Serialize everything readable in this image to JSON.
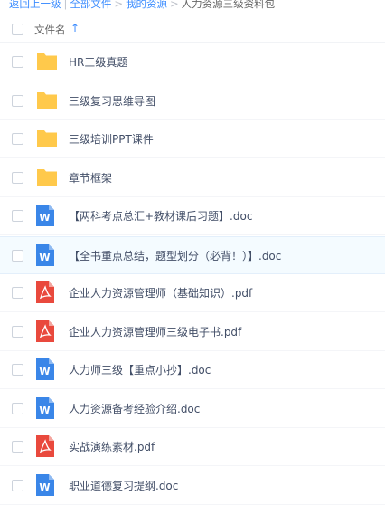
{
  "breadcrumb": {
    "back": "返回上一级",
    "sep1": "|",
    "all_files": "全部文件",
    "sep2": ">",
    "my_resources": "我的资源",
    "sep3": ">",
    "current": "人力资源三级资料包"
  },
  "header": {
    "column_label": "文件名",
    "sort_icon": "↑"
  },
  "files": [
    {
      "name": "HR三级真题",
      "type": "folder"
    },
    {
      "name": "三级复习思维导图",
      "type": "folder"
    },
    {
      "name": "三级培训PPT课件",
      "type": "folder"
    },
    {
      "name": "章节框架",
      "type": "folder"
    },
    {
      "name": "【两科考点总汇+教材课后习题】.doc",
      "type": "doc"
    },
    {
      "name": "【全书重点总结，题型划分（必背！）】.doc",
      "type": "doc"
    },
    {
      "name": "企业人力资源管理师（基础知识）.pdf",
      "type": "pdf"
    },
    {
      "name": "企业人力资源管理师三级电子书.pdf",
      "type": "pdf"
    },
    {
      "name": "人力师三级【重点小抄】.doc",
      "type": "doc"
    },
    {
      "name": "人力资源备考经验介绍.doc",
      "type": "doc"
    },
    {
      "name": "实战演练素材.pdf",
      "type": "pdf"
    },
    {
      "name": "职业道德复习提纲.doc",
      "type": "doc"
    }
  ],
  "colors": {
    "link": "#3b8cff",
    "folder": "#ffc94b",
    "doc": "#3a86e8",
    "pdf": "#e9493d",
    "row_hover": "#f4fbff"
  }
}
